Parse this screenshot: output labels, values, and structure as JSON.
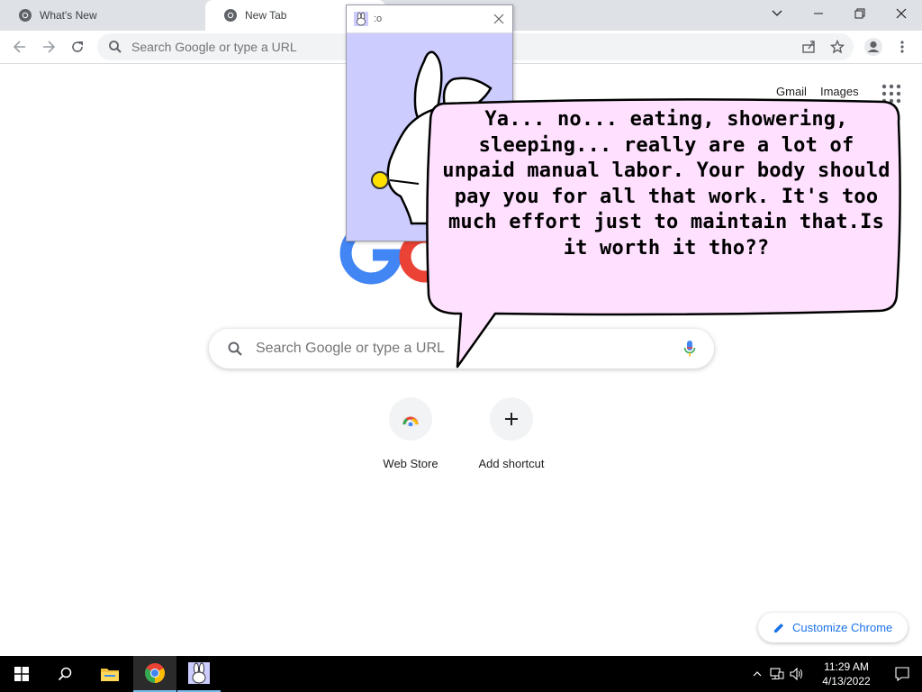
{
  "browser": {
    "tabs": [
      {
        "title": "What's New",
        "active": false
      },
      {
        "title": "New Tab",
        "active": true
      }
    ],
    "omnibox": {
      "placeholder": "Search Google or type a URL"
    }
  },
  "ntp": {
    "links": [
      "Gmail",
      "Images"
    ],
    "search_placeholder": "Search Google or type a URL",
    "shortcuts": [
      {
        "label": "Web Store",
        "icon": "webstore-icon"
      },
      {
        "label": "Add shortcut",
        "icon": "plus-icon"
      }
    ],
    "customize_label": "Customize Chrome",
    "logo_colors": {
      "blue": "#4285f4",
      "red": "#ea4335",
      "yellow": "#fbbc05",
      "green": "#34a853"
    }
  },
  "popup": {
    "title": ":o",
    "background": "#ccccff"
  },
  "bubble": {
    "text": "Ya... no... eating, showering, sleeping... really are a lot of unpaid manual labor. Your body should pay you for all that work. It's too much effort just to maintain that.Is it worth it tho??",
    "fill": "#ffe0ff"
  },
  "taskbar": {
    "apps": [
      "windows-start-icon",
      "search-icon",
      "file-explorer-icon",
      "chrome-icon",
      "bunny-app-icon"
    ],
    "time": "11:29 AM",
    "date": "4/13/2022"
  }
}
